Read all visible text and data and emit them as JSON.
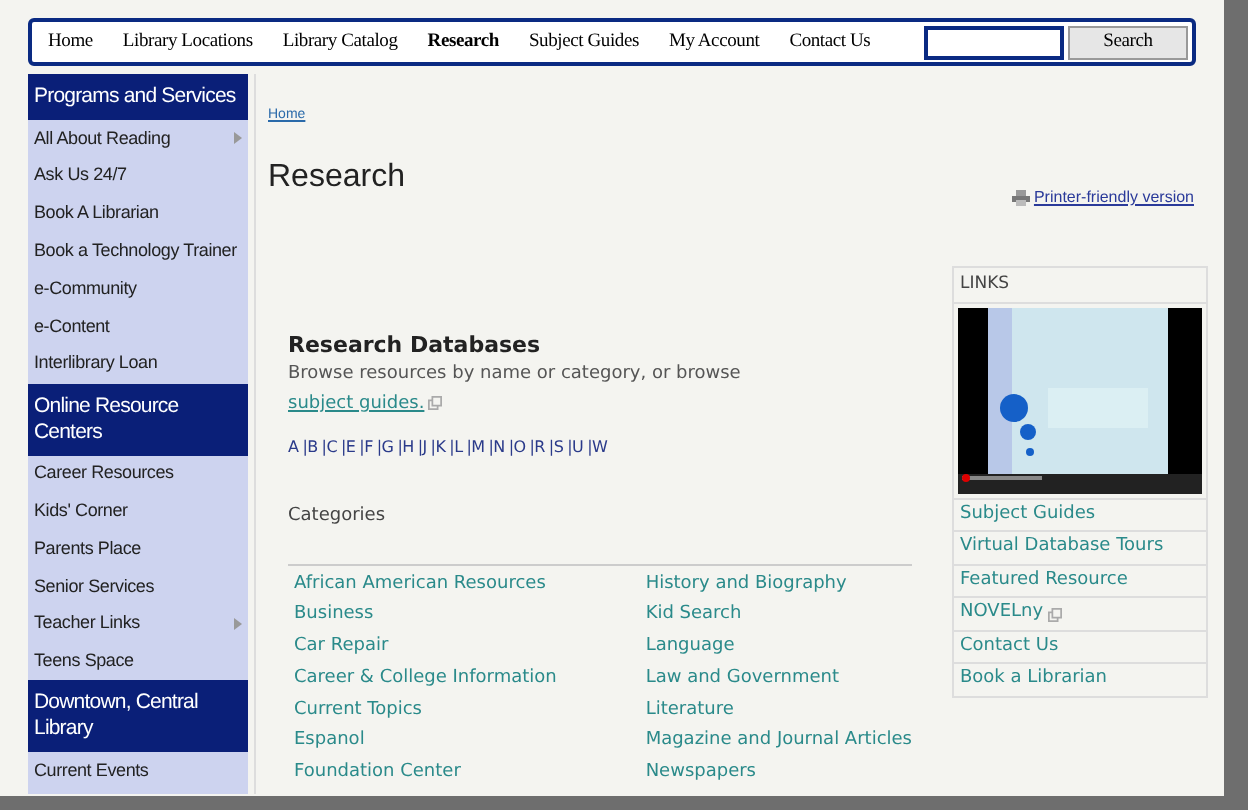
{
  "nav": {
    "items": [
      {
        "label": "Home",
        "selected": false
      },
      {
        "label": "Library Locations",
        "selected": false
      },
      {
        "label": "Library Catalog",
        "selected": false
      },
      {
        "label": "Research",
        "selected": true
      },
      {
        "label": "Subject Guides",
        "selected": false
      },
      {
        "label": "My Account",
        "selected": false
      },
      {
        "label": "Contact Us",
        "selected": false
      }
    ],
    "search_button": "Search"
  },
  "sidebar": [
    {
      "heading": "Programs and Services",
      "items": [
        {
          "label": "All About Reading",
          "has_submenu": true
        },
        {
          "label": "Ask Us 24/7",
          "has_submenu": false
        },
        {
          "label": "Book A Librarian",
          "has_submenu": false
        },
        {
          "label": "Book a Technology Trainer",
          "has_submenu": false
        },
        {
          "label": "e-Community",
          "has_submenu": false
        },
        {
          "label": "e-Content",
          "has_submenu": false
        },
        {
          "label": "Interlibrary Loan",
          "has_submenu": false
        }
      ]
    },
    {
      "heading": "Online Resource Centers",
      "items": [
        {
          "label": "Career Resources",
          "has_submenu": false
        },
        {
          "label": "Kids' Corner",
          "has_submenu": false
        },
        {
          "label": "Parents Place",
          "has_submenu": false
        },
        {
          "label": "Senior Services",
          "has_submenu": false
        },
        {
          "label": "Teacher Links",
          "has_submenu": true
        },
        {
          "label": "Teens Space",
          "has_submenu": false
        }
      ]
    },
    {
      "heading": "Downtown, Central Library",
      "items": [
        {
          "label": "Current Events",
          "has_submenu": false
        }
      ]
    }
  ],
  "breadcrumb": "Home",
  "title": "Research",
  "printer_link": "Printer-friendly version",
  "databases": {
    "heading": "Research Databases",
    "intro": "Browse resources by name or category, or browse",
    "intro_link": "subject guides.",
    "letters": [
      "A",
      "B",
      "C",
      "E",
      "F",
      "G",
      "H",
      "J",
      "K",
      "L",
      "M",
      "N",
      "O",
      "R",
      "S",
      "U",
      "W"
    ],
    "separator": "|",
    "categories_label": "Categories",
    "categories_left": [
      "African American Resources",
      "Business",
      "Car Repair",
      "Career & College Information",
      "Current Topics",
      "Espanol",
      "Foundation Center"
    ],
    "categories_right": [
      "History and Biography",
      "Kid Search",
      "Language",
      "Law and Government",
      "Literature",
      "Magazine and Journal Articles",
      "Newspapers"
    ]
  },
  "links_box": {
    "heading": "LINKS",
    "links": [
      {
        "label": "Subject Guides",
        "external": false
      },
      {
        "label": "Virtual Database Tours",
        "external": false
      },
      {
        "label": "Featured Resource",
        "external": false
      },
      {
        "label": "NOVELny",
        "external": true
      },
      {
        "label": "Contact Us",
        "external": false
      },
      {
        "label": "Book a Librarian",
        "external": false
      }
    ]
  }
}
